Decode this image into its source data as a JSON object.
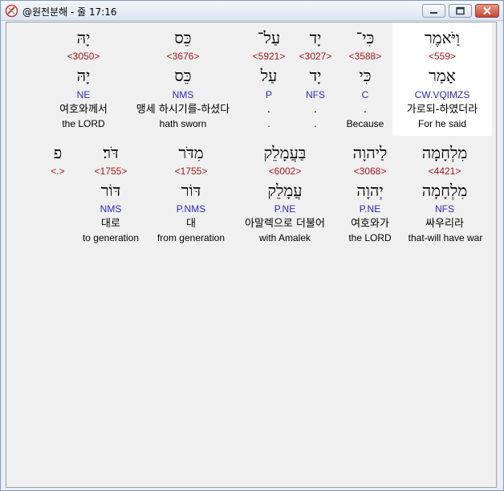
{
  "window": {
    "title": "@원전분해 - 줄 17:16"
  },
  "rows": [
    [
      {
        "heb": "וַיֹּאמֶר",
        "strong": "<559>",
        "lemma": "אָמַר",
        "morph": "CW.VQIMZS",
        "ko": "가로되-하였더라",
        "en": "For he said"
      },
      {
        "heb": "כִּי־",
        "strong": "<3588>",
        "lemma": "כִּי",
        "morph": "C",
        "ko": ".",
        "en": "Because"
      },
      {
        "heb": "יָד",
        "strong": "<3027>",
        "lemma": "יָד",
        "morph": "NFS",
        "ko": ".",
        "en": "."
      },
      {
        "heb": "עַל־",
        "strong": "<5921>",
        "lemma": "עַל",
        "morph": "P",
        "ko": ".",
        "en": "."
      },
      {
        "heb": "כֵּס",
        "strong": "<3676>",
        "lemma": "כֵּס",
        "morph": "NMS",
        "ko": "맹세 하시기를-하셨다",
        "en": "hath sworn"
      },
      {
        "heb": "יָהּ",
        "strong": "<3050>",
        "lemma": "יָהּ",
        "morph": "NE",
        "ko": "여호와께서",
        "en": "the LORD"
      }
    ],
    [
      {
        "heb": "מִלְחָמָה",
        "strong": "<4421>",
        "lemma": "מִלְחָמָה",
        "morph": "NFS",
        "ko": "싸우리라",
        "en": "that-will have war"
      },
      {
        "heb": "לַיהוָה",
        "strong": "<3068>",
        "lemma": "יְהוָה",
        "morph": "P.NE",
        "ko": "여호와가",
        "en": "the LORD"
      },
      {
        "heb": "בַּעֲמָלֵק",
        "strong": "<6002>",
        "lemma": "עֲמָלֵק",
        "morph": "P.NE",
        "ko": "아말렉으로 더불어",
        "en": "with Amalek"
      },
      {
        "heb": "מִדֹּר",
        "strong": "<1755>",
        "lemma": "דּוֹר",
        "morph": "P.NMS",
        "ko": "대",
        "en": "from generation"
      },
      {
        "heb": "דֹּר׃",
        "strong": "<1755>",
        "lemma": "דּוֹר",
        "morph": "NMS",
        "ko": "대로",
        "en": "to generation"
      },
      {
        "heb": "פ",
        "strong": "<.>"
      }
    ]
  ]
}
